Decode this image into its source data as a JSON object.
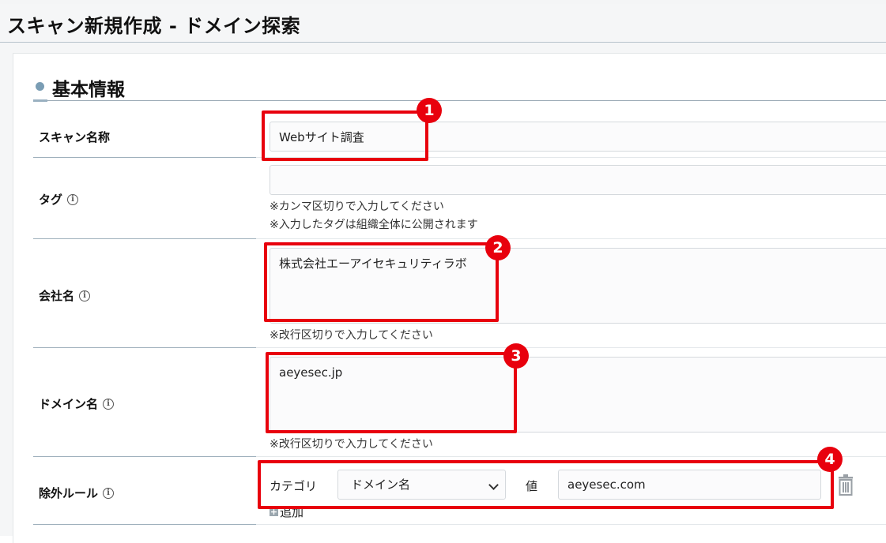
{
  "page": {
    "title": "スキャン新規作成 - ドメイン探索"
  },
  "section": {
    "title": "基本情報"
  },
  "fields": {
    "scan_name": {
      "label": "スキャン名称",
      "value": "Webサイト調査"
    },
    "tag": {
      "label": "タグ",
      "value": "",
      "help_1": "※カンマ区切りで入力してください",
      "help_2": "※入力したタグは組織全体に公開されます"
    },
    "company": {
      "label": "会社名",
      "value": "株式会社エーアイセキュリティラボ",
      "help": "※改行区切りで入力してください"
    },
    "domain": {
      "label": "ドメイン名",
      "value": "aeyesec.jp",
      "help": "※改行区切りで入力してください"
    },
    "exclusion": {
      "label": "除外ルール",
      "category_label": "カテゴリ",
      "category_value": "ドメイン名",
      "value_label": "値",
      "value": "aeyesec.com",
      "add_label": "追加"
    }
  },
  "annotations": [
    "1",
    "2",
    "3",
    "4"
  ],
  "icons": {
    "info": "info-circle-icon",
    "delete": "trash-icon",
    "add": "plus-square-icon",
    "dropdown": "chevron-down-icon"
  },
  "colors": {
    "highlight": "#e8000d",
    "section_accent": "#7a9db4"
  }
}
